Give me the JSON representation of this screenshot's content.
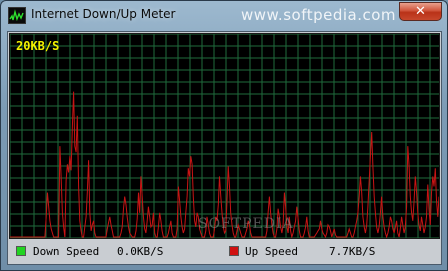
{
  "window": {
    "title": "Internet Down/Up Meter",
    "watermark": "www.softpedia.com",
    "close_glyph": "✕",
    "icon": "meter-app-icon"
  },
  "graph": {
    "scale_label": "20KB/S",
    "watermark": "SOFTPEDIA",
    "grid_color": "#1f6b3c",
    "background_color": "#000000",
    "up_color": "#c81414",
    "down_color": "#22d322",
    "up_speed_history": [
      0,
      0,
      0,
      0,
      0,
      0,
      0,
      0,
      0,
      0,
      0,
      0,
      0,
      0,
      0,
      0,
      0,
      0,
      0,
      0,
      0,
      0,
      0,
      0,
      0,
      0,
      0,
      0,
      0,
      0.1,
      0.22,
      0.15,
      0.08,
      0.04,
      0.02,
      0,
      0,
      0,
      0,
      0,
      0.45,
      0.3,
      0.12,
      0.05,
      0,
      0.28,
      0.36,
      0.32,
      0.4,
      0.33,
      0.55,
      0.72,
      0.45,
      0.42,
      0.6,
      0.25,
      0.08,
      0.03,
      0,
      0,
      0.05,
      0.1,
      0.22,
      0.38,
      0.12,
      0.03,
      0.06,
      0.08,
      0.02,
      0,
      0,
      0,
      0,
      0,
      0,
      0,
      0,
      0,
      0.04,
      0.07,
      0.1,
      0.06,
      0.03,
      0,
      0,
      0,
      0,
      0,
      0,
      0.02,
      0.05,
      0.14,
      0.2,
      0.16,
      0.1,
      0.05,
      0.02,
      0.01,
      0,
      0,
      0,
      0.03,
      0.09,
      0.22,
      0.12,
      0.3,
      0.2,
      0.1,
      0.04,
      0.02,
      0.08,
      0.15,
      0.1,
      0.05,
      0.06,
      0.12,
      0.02,
      0,
      0,
      0.05,
      0.12,
      0.08,
      0.03,
      0,
      0,
      0,
      0,
      0.02,
      0.05,
      0.08,
      0.02,
      0,
      0,
      0,
      0.04,
      0.25,
      0.18,
      0.1,
      0.05,
      0.02,
      0.04,
      0.12,
      0.2,
      0.34,
      0.3,
      0.4,
      0.36,
      0.2,
      0.08,
      0.05,
      0.12,
      0.1,
      0.04,
      0.02,
      0,
      0,
      0,
      0.03,
      0.1,
      0.06,
      0.02,
      0,
      0,
      0,
      0.04,
      0.1,
      0.08,
      0.16,
      0.3,
      0.2,
      0.12,
      0.05,
      0.02,
      0.03,
      0.18,
      0.35,
      0.25,
      0.12,
      0.06,
      0.02,
      0,
      0,
      0.03,
      0.06,
      0.04,
      0.02,
      0,
      0,
      0,
      0.02,
      0.04,
      0.08,
      0.06,
      0.02,
      0,
      0,
      0,
      0,
      0,
      0,
      0,
      0,
      0,
      0,
      0,
      0,
      0.03,
      0.12,
      0.2,
      0.12,
      0.06,
      0.02,
      0,
      0,
      0.04,
      0.14,
      0.1,
      0.05,
      0.02,
      0.06,
      0.22,
      0.15,
      0.05,
      0.02,
      0.1,
      0.03,
      0,
      0.02,
      0.05,
      0.08,
      0.15,
      0.09,
      0.03,
      0,
      0,
      0,
      0.02,
      0.05,
      0.1,
      0.03,
      0,
      0,
      0,
      0,
      0,
      0.01,
      0.02,
      0.03,
      0.04,
      0.08,
      0.04,
      0.02,
      0.01,
      0,
      0.02,
      0.06,
      0.05,
      0.03,
      0,
      0.02,
      0.04,
      0.01,
      0,
      0,
      0,
      0,
      0,
      0,
      0,
      0,
      0,
      0.02,
      0.04,
      0.02,
      0,
      0,
      0.02,
      0.05,
      0.08,
      0.12,
      0.2,
      0.3,
      0.22,
      0.1,
      0.05,
      0.02,
      0.06,
      0.15,
      0.28,
      0.4,
      0.52,
      0.35,
      0.2,
      0.12,
      0.05,
      0.02,
      0.05,
      0.12,
      0.2,
      0.1,
      0.05,
      0.02,
      0,
      0.02,
      0.05,
      0.1,
      0.08,
      0.04,
      0.02,
      0.05,
      0.08,
      0.02,
      0,
      0.04,
      0.1,
      0.06,
      0.02,
      0.05,
      0.15,
      0.45,
      0.35,
      0.2,
      0.12,
      0.08,
      0.18,
      0.3,
      0.22,
      0.12,
      0.06,
      0.03,
      0.1,
      0.06,
      0.02,
      0.05,
      0.1,
      0.26,
      0.14,
      0.06,
      0.22,
      0.3,
      0.25,
      0.34,
      0.18,
      0.1,
      0.2
    ]
  },
  "status": {
    "down_label": "Down Speed",
    "down_value": "0.0KB/S",
    "up_label": "Up Speed",
    "up_value": "7.7KB/S"
  }
}
